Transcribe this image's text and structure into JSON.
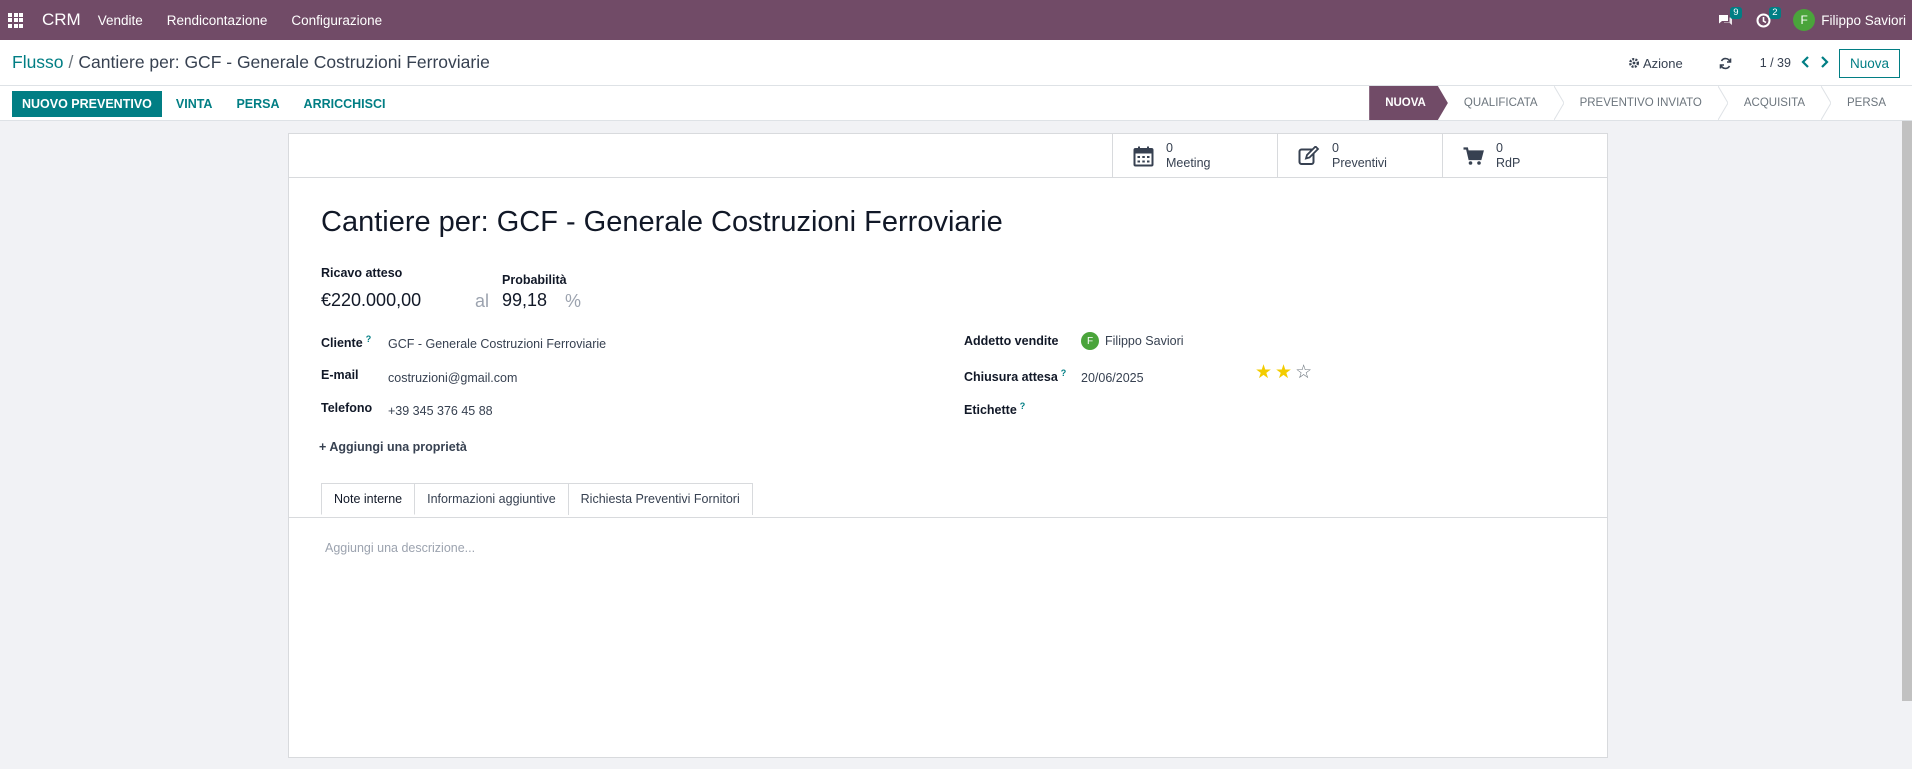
{
  "topbar": {
    "app": "CRM",
    "menu": [
      "Vendite",
      "Rendicontazione",
      "Configurazione"
    ],
    "messages_count": "9",
    "activities_count": "2",
    "user_initial": "F",
    "user_name": "Filippo Saviori"
  },
  "control_panel": {
    "breadcrumb_parent": "Flusso",
    "breadcrumb_sep": "/",
    "breadcrumb_current": "Cantiere per: GCF - Generale Costruzioni Ferroviarie",
    "action_label": "Azione",
    "pager": "1 / 39",
    "new_label": "Nuova"
  },
  "statusbar": {
    "primary_button": "NUOVO PREVENTIVO",
    "buttons": [
      "VINTA",
      "PERSA",
      "ARRICCHISCI"
    ],
    "stages": [
      "NUOVA",
      "QUALIFICATA",
      "PREVENTIVO INVIATO",
      "ACQUISITA",
      "PERSA"
    ],
    "active_stage": "NUOVA"
  },
  "smart_buttons": [
    {
      "count": "0",
      "label": "Meeting",
      "icon": "calendar-icon"
    },
    {
      "count": "0",
      "label": "Preventivi",
      "icon": "edit-icon"
    },
    {
      "count": "0",
      "label": "RdP",
      "icon": "cart-icon"
    }
  ],
  "record": {
    "title": "Cantiere per: GCF - Generale Costruzioni Ferroviarie",
    "expected_revenue_label": "Ricavo atteso",
    "expected_revenue": "€220.000,00",
    "at_label": "al",
    "probability_label": "Probabilità",
    "probability": "99,18",
    "percent": "%",
    "customer_label": "Cliente",
    "customer": "GCF - Generale Costruzioni Ferroviarie",
    "email_label": "E-mail",
    "email": "costruzioni@gmail.com",
    "phone_label": "Telefono",
    "phone": "+39 345 376 45 88",
    "salesperson_label": "Addetto vendite",
    "salesperson_initial": "F",
    "salesperson": "Filippo Saviori",
    "deadline_label": "Chiusura attesa",
    "deadline": "20/06/2025",
    "priority_stars": 2,
    "priority_max": 3,
    "tags_label": "Etichette",
    "help_mark": "?",
    "add_property": "Aggiungi una proprietà"
  },
  "tabs": [
    "Note interne",
    "Informazioni aggiuntive",
    "Richiesta Preventivi Fornitori"
  ],
  "active_tab": "Note interne",
  "description_placeholder": "Aggiungi una descrizione...",
  "colors": {
    "brand": "#714b67",
    "accent": "#017e84",
    "star": "#f3cc00",
    "avatar": "#4aa43b"
  }
}
